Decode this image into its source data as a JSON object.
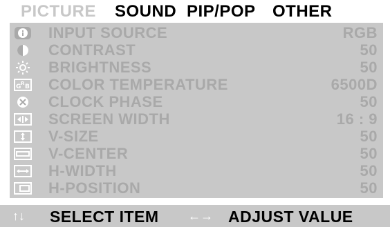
{
  "tabs": [
    {
      "label": "PICTURE",
      "active": true
    },
    {
      "label": "SOUND",
      "active": false
    },
    {
      "label": "PIP/POP",
      "active": false
    },
    {
      "label": "OTHER",
      "active": false
    }
  ],
  "items": [
    {
      "icon": "info-icon",
      "label": "INPUT SOURCE",
      "value": "RGB"
    },
    {
      "icon": "contrast-icon",
      "label": "CONTRAST",
      "value": "50"
    },
    {
      "icon": "brightness-icon",
      "label": "BRIGHTNESS",
      "value": "50"
    },
    {
      "icon": "color-temperature-icon",
      "label": "COLOR TEMPERATURE",
      "value": "6500D"
    },
    {
      "icon": "clock-phase-icon",
      "label": "CLOCK PHASE",
      "value": "50"
    },
    {
      "icon": "screen-width-icon",
      "label": "SCREEN WIDTH",
      "value": "16 : 9"
    },
    {
      "icon": "v-size-icon",
      "label": "V-SIZE",
      "value": "50"
    },
    {
      "icon": "v-center-icon",
      "label": "V-CENTER",
      "value": "50"
    },
    {
      "icon": "h-width-icon",
      "label": "H-WIDTH",
      "value": "50"
    },
    {
      "icon": "h-position-icon",
      "label": "H-POSITION",
      "value": "50"
    }
  ],
  "footer": {
    "select_arrows": "↑↓",
    "select_label": "SELECT ITEM",
    "adjust_arrows": "←→",
    "adjust_label": "ADJUST VALUE"
  },
  "colors": {
    "panel": "#c8c8c8",
    "item_text": "#a9a9a9",
    "active_tab": "#c8c8c8",
    "inactive_tab": "#000000",
    "hint_arrows": "#ffffff"
  }
}
